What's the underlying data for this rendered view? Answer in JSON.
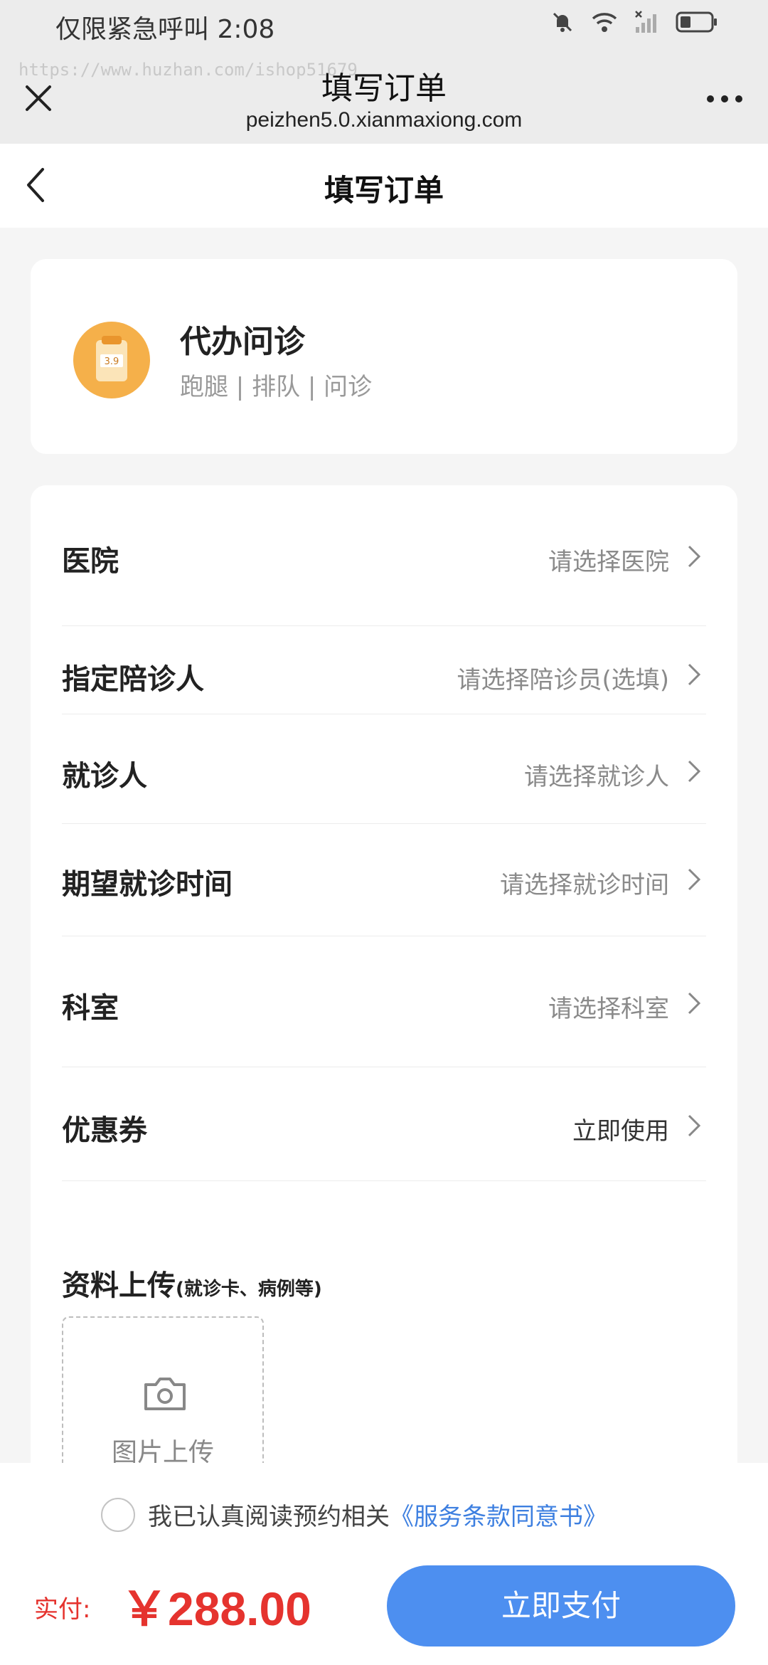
{
  "status_bar": {
    "text": "仅限紧急呼叫 2:08"
  },
  "browser": {
    "watermark": "https://www.huzhan.com/ishop51679",
    "title": "填写订单",
    "url": "peizhen5.0.xianmaxiong.com"
  },
  "nav": {
    "title": "填写订单"
  },
  "service": {
    "name": "代办问诊",
    "tags": "跑腿 | 排队 | 问诊",
    "icon_text": "3.9"
  },
  "form": {
    "rows": [
      {
        "label": "医院",
        "value": "请选择医院"
      },
      {
        "label": "指定陪诊人",
        "value": "请选择陪诊员(选填)"
      },
      {
        "label": "就诊人",
        "value": "请选择就诊人"
      },
      {
        "label": "期望就诊时间",
        "value": "请选择就诊时间"
      },
      {
        "label": "科室",
        "value": "请选择科室"
      },
      {
        "label": "优惠券",
        "value": "立即使用"
      }
    ],
    "upload_title": "资料上传",
    "upload_hint": "(就诊卡、病例等)",
    "upload_label": "图片上传"
  },
  "agreement": {
    "text": "我已认真阅读预约相关",
    "link": "《服务条款同意书》"
  },
  "payment": {
    "label": "实付:",
    "amount": "￥288.00",
    "button": "立即支付"
  },
  "colors": {
    "accent": "#4d8ff0",
    "price": "#e5332e",
    "link": "#3d7fe0"
  }
}
